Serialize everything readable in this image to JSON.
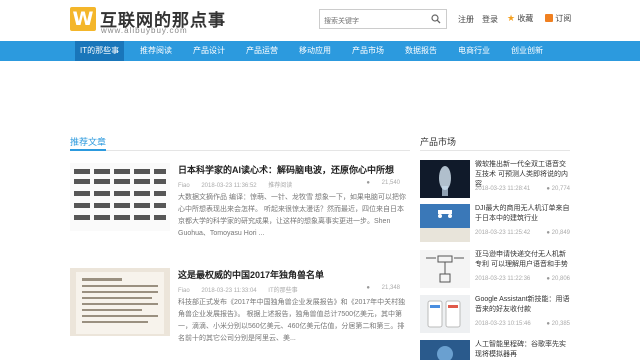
{
  "header": {
    "logo_glyph": "W",
    "site_title": "互联网的那点事",
    "site_domain": "www.alibuybuy.com",
    "search_placeholder": "搜索关键字",
    "register": "注册",
    "login": "登录",
    "favorite": "收藏",
    "subscribe": "订阅",
    "search_icon": "search-icon",
    "star_icon": "star-icon",
    "rss_icon": "rss-icon",
    "accent_color": "#2c9ade",
    "logo_color": "#f4b62a"
  },
  "nav": {
    "items": [
      "IT的那些事",
      "推荐阅读",
      "产品设计",
      "产品运营",
      "移动应用",
      "产品市场",
      "数据报告",
      "电商行业",
      "创业创新"
    ],
    "active_index": 0
  },
  "recommended": {
    "title": "推荐文章",
    "articles": [
      {
        "title": "日本科学家的AI读心术：解码脑电波，还原你心中所想",
        "author": "Fiao",
        "date": "2018-03-23 11:36:52",
        "category": "推荐阅读",
        "views": "21,540",
        "desc": "大数据文摘作品 编译：惊萌、一针、龙牧雪 想象一下，如果电脑可以把你心中所想表现出来会怎样。 听起来很惊太漫话？然而最近，四位来自日本京都大学的科学家的研究成果，让这样的想象离事实更进一步。Shen Guohua、Tomoyasu Hori ..."
      },
      {
        "title": "这是最权威的中国2017年独角兽名单",
        "author": "Fiao",
        "date": "2018-03-23 11:33:04",
        "category": "IT的那些事",
        "views": "21,348",
        "desc": "科技部正式发布《2017年中国独角兽企业发展报告》和《2017年中关村独角兽企业发展报告》。 根据上述报告，独角兽值总计7500亿美元，其中第一，滴滴、小米分别以560亿美元、460亿美元估值，分居第二和第三。排名前十的其它公司分别是阿里云、美..."
      }
    ]
  },
  "market": {
    "title": "产品市场",
    "items": [
      {
        "title": "微软推出新一代全双工语音交互技术 可预测人类即将说的内容",
        "date": "2018-03-23 11:28:41",
        "views": "20,774"
      },
      {
        "title": "DJI最大的商用无人机订单来自于日本中的建筑行业",
        "date": "2018-03-23 11:25:42",
        "views": "20,849"
      },
      {
        "title": "亚马逊申请快递交付无人机新专利 可以理解用户语音和手势",
        "date": "2018-03-23 11:22:36",
        "views": "20,806"
      },
      {
        "title": "Google Assistant新技能：用语音来的好友收付款",
        "date": "2018-03-23 10:15:46",
        "views": "20,385"
      },
      {
        "title": "人工智能里程碑：谷歌率先实现将模拟器再",
        "date": "",
        "views": ""
      }
    ]
  }
}
